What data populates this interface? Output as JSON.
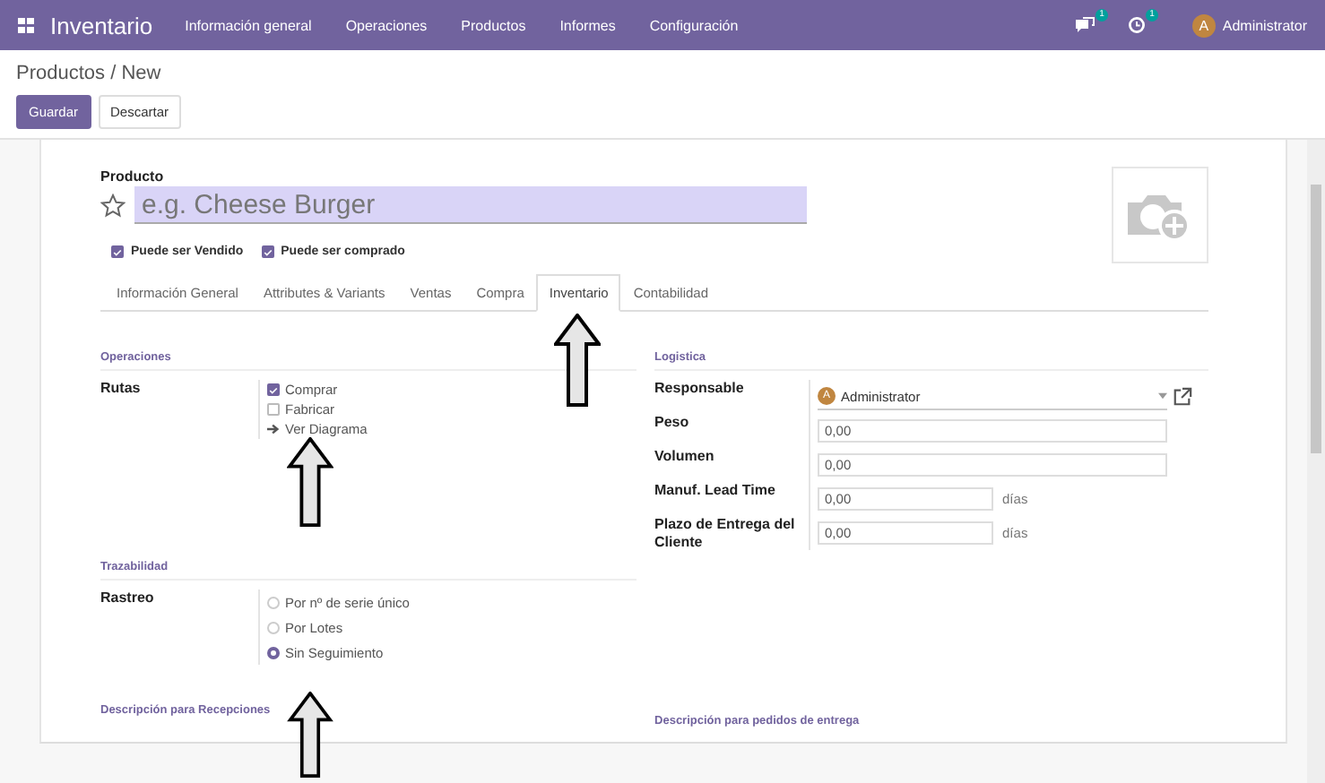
{
  "navbar": {
    "app_title": "Inventario",
    "menu": [
      "Información general",
      "Operaciones",
      "Productos",
      "Informes",
      "Configuración"
    ],
    "messages_badge": "1",
    "activities_badge": "1",
    "user": {
      "initial": "A",
      "name": "Administrator"
    }
  },
  "breadcrumb": "Productos / New",
  "buttons": [
    {
      "label": "Guardar",
      "kind": "primary"
    },
    {
      "label": "Descartar",
      "kind": "secondary"
    }
  ],
  "product": {
    "label": "Producto",
    "name_placeholder": "e.g. Cheese Burger",
    "favorite": false
  },
  "options": [
    {
      "label": "Puede ser Vendido",
      "checked": true
    },
    {
      "label": "Puede ser comprado",
      "checked": true
    }
  ],
  "tabs": [
    {
      "label": "Información General",
      "selected": false
    },
    {
      "label": "Attributes & Variants",
      "selected": false
    },
    {
      "label": "Ventas",
      "selected": false
    },
    {
      "label": "Compra",
      "selected": false
    },
    {
      "label": "Inventario",
      "selected": true
    },
    {
      "label": "Contabilidad",
      "selected": false
    }
  ],
  "operaciones": {
    "title": "Operaciones",
    "label": "Rutas",
    "routes": [
      {
        "label": "Comprar",
        "checked": true
      },
      {
        "label": "Fabricar",
        "checked": false
      }
    ],
    "link": "Ver Diagrama"
  },
  "logistica": {
    "title": "Logistica",
    "fields": [
      {
        "label": "Responsable",
        "kind": "user",
        "initial": "A",
        "value": "Administrator"
      },
      {
        "label": "Peso",
        "kind": "number",
        "value": "0,00"
      },
      {
        "label": "Volumen",
        "kind": "number",
        "value": "0,00"
      },
      {
        "label": "Manuf. Lead Time",
        "kind": "duration",
        "value": "0,00",
        "unit": "días"
      },
      {
        "label": "Plazo de Entrega del Cliente",
        "kind": "duration",
        "value": "0,00",
        "unit": "días"
      }
    ]
  },
  "trazabilidad": {
    "title": "Trazabilidad",
    "label": "Rastreo",
    "options": [
      {
        "label": "Por nº de serie único",
        "selected": false
      },
      {
        "label": "Por Lotes",
        "selected": false
      },
      {
        "label": "Sin Seguimiento",
        "selected": true
      }
    ]
  },
  "descriptions": [
    "Descripción para Recepciones",
    "Descripción para pedidos de entrega"
  ]
}
